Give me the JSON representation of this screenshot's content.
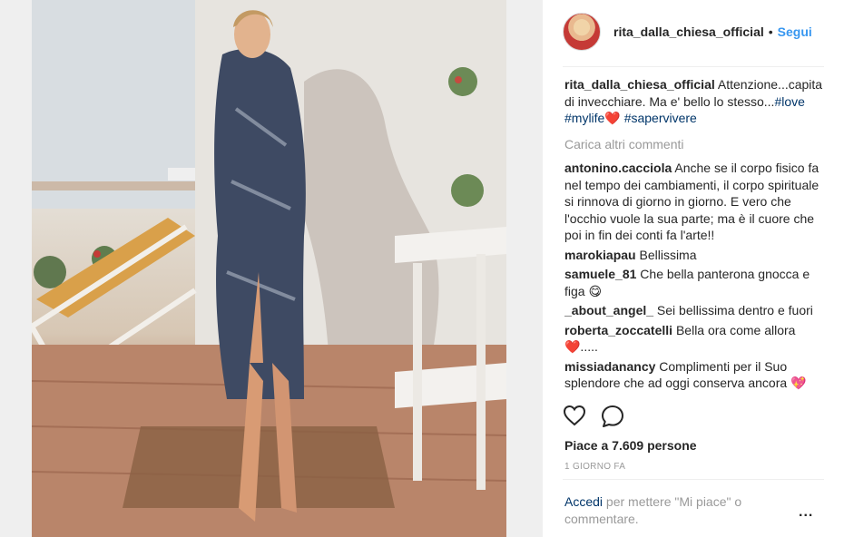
{
  "post": {
    "username": "rita_dalla_chiesa_official",
    "separator": "•",
    "follow_label": "Segui",
    "caption": {
      "username": "rita_dalla_chiesa_official",
      "text": "Attenzione...capita di invecchiare. Ma e' bello lo stesso...",
      "tag_love": "#love",
      "tag_mylife": "#mylife",
      "heart": "❤️",
      "tag_sapervivere": "#sapervivere"
    },
    "load_more": "Carica altri commenti",
    "comments": [
      {
        "user": "antonino.cacciola",
        "text": "Anche se il corpo fisico fa nel tempo dei cambiamenti, il corpo spirituale si rinnova di giorno in giorno. E vero che l'occhio vuole la sua parte; ma è il cuore che poi in fin dei conti fa l'arte!!"
      },
      {
        "user": "marokiapau",
        "text": "Bellissima"
      },
      {
        "user": "samuele_81",
        "text": "Che bella panterona gnocca e figa 😋"
      },
      {
        "user": "_about_angel_",
        "text": "Sei bellissima dentro e fuori"
      },
      {
        "user": "roberta_zoccatelli",
        "text": "Bella ora come allora ❤️....."
      },
      {
        "user": "missiadanancy",
        "text": "Complimenti per il Suo splendore che ad oggi conserva ancora 💖"
      }
    ],
    "likes": "Piace a 7.609 persone",
    "time": "1 GIORNO FA",
    "login_link": "Accedi",
    "login_text": " per mettere \"Mi piace\" o commentare.",
    "more_icon": "..."
  },
  "icons": {
    "like": "heart-outline-icon",
    "comment": "speech-bubble-icon",
    "options": "ellipsis-icon"
  },
  "colors": {
    "link_blue": "#3897f0",
    "hashtag": "#003569",
    "muted": "#999999"
  }
}
